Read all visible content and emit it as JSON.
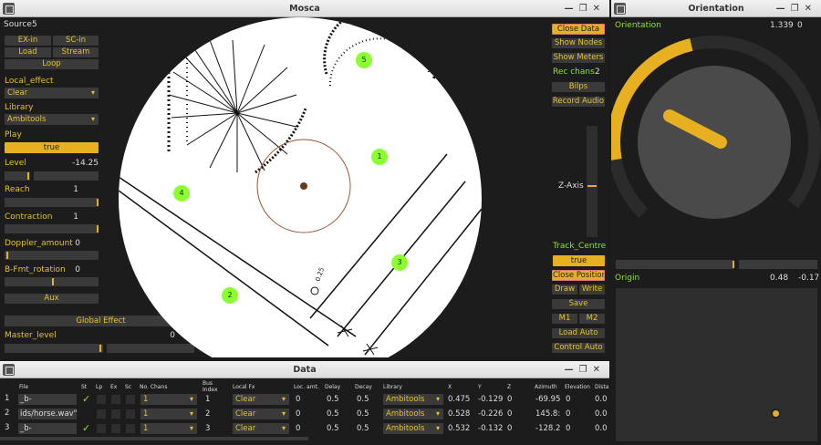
{
  "mosca": {
    "title": "Mosca",
    "source_label": "Source",
    "source_num": "5",
    "buttons": {
      "ex_in": "EX-in",
      "sc_in": "SC-in",
      "load": "Load",
      "stream": "Stream",
      "loop": "Loop",
      "play_value": "true",
      "aux": "Aux",
      "global_effect": "Global Effect"
    },
    "labels": {
      "local_effect": "Local_effect",
      "library": "Library",
      "play": "Play",
      "level": "Level",
      "reach": "Reach",
      "contraction": "Contraction",
      "doppler": "Doppler_amount",
      "bfmt": "B-Fmt_rotation",
      "master": "Master_level"
    },
    "dropdowns": {
      "local_effect": "Clear",
      "library": "Ambitools"
    },
    "values": {
      "level": "-14.25",
      "reach": "1",
      "contraction": "1",
      "doppler": "0",
      "bfmt": "0",
      "master": "0"
    },
    "sliders": {
      "level": 0.7,
      "reach": 1.0,
      "contraction": 1.0,
      "doppler": 0.0,
      "bfmt": 0.5,
      "master": 0.0
    },
    "right": {
      "close_data": "Close Data",
      "show_nodes": "Show Nodes",
      "show_meters": "Show Meters",
      "rec_chans_label": "Rec chans",
      "rec_chans_value": "2",
      "bilps": "Bilps",
      "record_audio": "Record Audio",
      "z_axis": "Z-Axis",
      "track_centre": "Track_Centre",
      "track_value": "true",
      "close_position": "Close Position",
      "draw": "Draw",
      "write": "Write",
      "save": "Save",
      "m1": "M1",
      "m2": "M2",
      "load_auto": "Load Auto",
      "control_auto": "Control Auto"
    },
    "sources": [
      "1",
      "2",
      "3",
      "4",
      "5"
    ],
    "plot_text": "0.25"
  },
  "orientation": {
    "title": "Orientation",
    "label": "Orientation",
    "val1": "1.339",
    "val2": "0",
    "origin_label": "Origin",
    "origin_x": "0.48",
    "origin_y": "-0.17",
    "knob": 0.71
  },
  "data": {
    "title": "Data",
    "headers": {
      "file": "File",
      "st": "St",
      "lp": "Lp",
      "ex": "Ex",
      "sc": "Sc",
      "chans": "No. Chans",
      "bus1": "Bus",
      "bus2": "Index",
      "fx": "Local Fx",
      "amt": "Loc. amt.",
      "delay": "Delay",
      "decay": "Decay",
      "library": "Library",
      "x": "X",
      "y": "Y",
      "z": "Z",
      "azimuth": "Azimuth",
      "elevation": "Elevation",
      "dist": "Dista"
    },
    "rows": [
      {
        "idx": "1",
        "file": "_b-format.wav\"",
        "st": "✓",
        "chans": "1",
        "bus": "1",
        "fx": "Clear",
        "amt": "0",
        "delay": "0.5",
        "decay": "0.5",
        "library": "Ambitools",
        "x": "0.475",
        "y": "-0.129",
        "z": "0",
        "azimuth": "-69.95",
        "elevation": "0",
        "dist": "0.0"
      },
      {
        "idx": "2",
        "file": "ids/horse.wav\"",
        "st": "",
        "chans": "1",
        "bus": "2",
        "fx": "Clear",
        "amt": "0",
        "delay": "0.5",
        "decay": "0.5",
        "library": "Ambitools",
        "x": "0.528",
        "y": "-0.226",
        "z": "0",
        "azimuth": "145.8:",
        "elevation": "0",
        "dist": "0.0"
      },
      {
        "idx": "3",
        "file": "_b-format.wav\"",
        "st": "✓",
        "chans": "1",
        "bus": "3",
        "fx": "Clear",
        "amt": "0",
        "delay": "0.5",
        "decay": "0.5",
        "library": "Ambitools",
        "x": "0.532",
        "y": "-0.132",
        "z": "0",
        "azimuth": "-128.2",
        "elevation": "0",
        "dist": "0.0"
      }
    ]
  }
}
